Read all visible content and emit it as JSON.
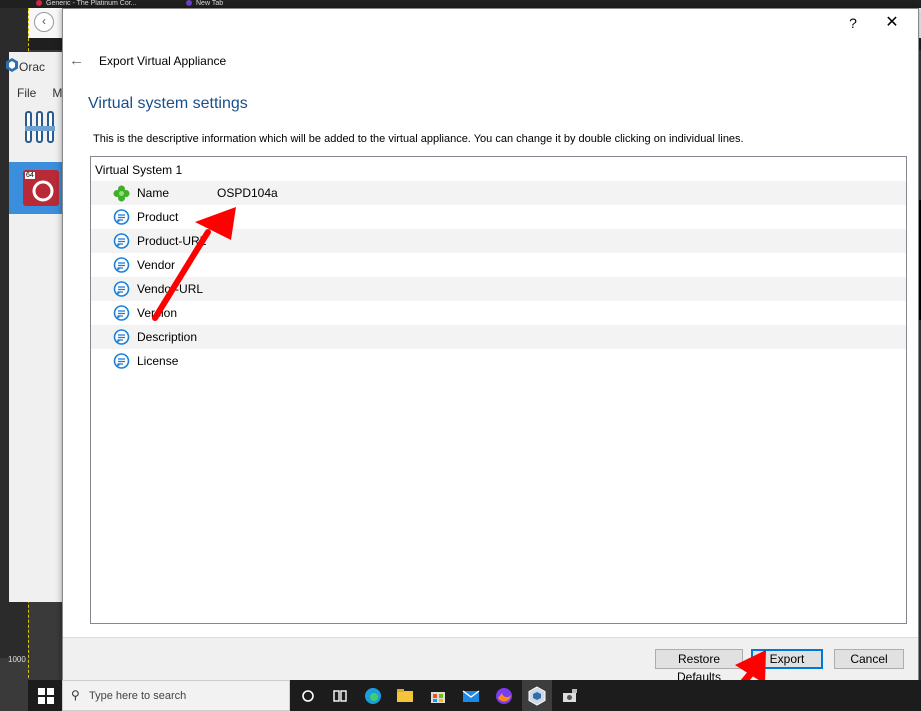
{
  "browser": {
    "tabs": [
      {
        "label": "Generic - The Platinum Cor...",
        "color": "#d7263d"
      },
      {
        "label": "New Tab",
        "color": "#6e40c9"
      }
    ]
  },
  "background_app": {
    "title": "Orac",
    "menu": [
      "File",
      "M"
    ],
    "vm_badge": "64"
  },
  "ruler": {
    "label": "1000"
  },
  "dialog": {
    "help_label": "?",
    "close_label": "✕",
    "back_label": "←",
    "title": "Export Virtual Appliance",
    "heading": "Virtual system settings",
    "description": "This is the descriptive information which will be added to the virtual appliance. You can change it by double clicking on individual lines.",
    "tree": {
      "root": "Virtual System 1",
      "rows": [
        {
          "key": "Name",
          "value": "OSPD104a",
          "icon": "name-icon"
        },
        {
          "key": "Product",
          "value": "",
          "icon": "speech-bubble-icon"
        },
        {
          "key": "Product-URL",
          "value": "",
          "icon": "speech-bubble-icon"
        },
        {
          "key": "Vendor",
          "value": "",
          "icon": "speech-bubble-icon"
        },
        {
          "key": "Vendor-URL",
          "value": "",
          "icon": "speech-bubble-icon"
        },
        {
          "key": "Version",
          "value": "",
          "icon": "speech-bubble-icon"
        },
        {
          "key": "Description",
          "value": "",
          "icon": "speech-bubble-icon"
        },
        {
          "key": "License",
          "value": "",
          "icon": "speech-bubble-icon"
        }
      ]
    },
    "buttons": {
      "restore": "Restore Defaults",
      "export": "Export",
      "cancel": "Cancel"
    }
  },
  "taskbar": {
    "search_placeholder": "Type here to search",
    "apps": [
      "cortana-icon",
      "task-view-icon",
      "edge-icon",
      "file-explorer-icon",
      "store-icon",
      "mail-icon",
      "firefox-icon",
      "virtualbox-icon",
      "snip-icon"
    ]
  },
  "colors": {
    "accent": "#0078d7",
    "heading": "#1b4f8a",
    "annotation_arrow": "#ff0000"
  }
}
